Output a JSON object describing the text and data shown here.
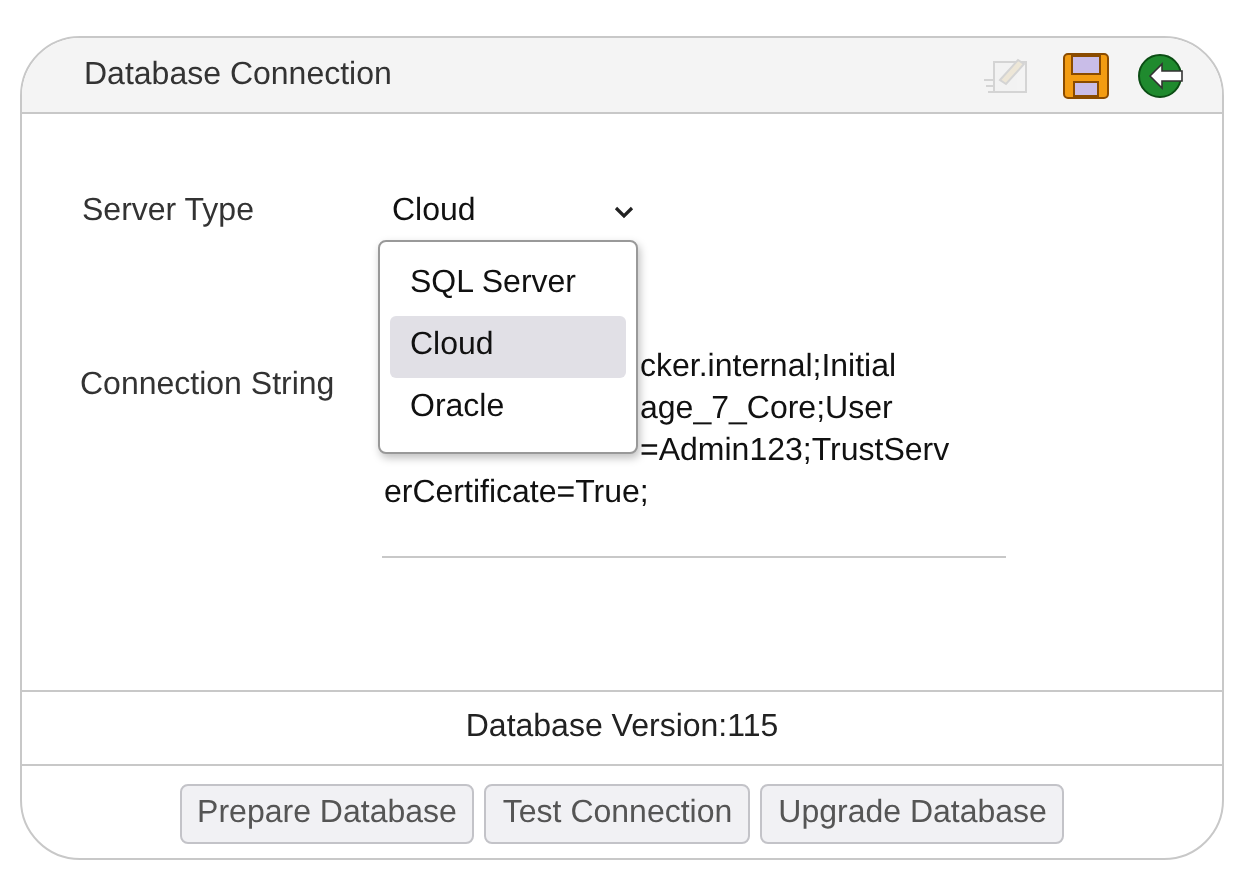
{
  "panel": {
    "title": "Database Connection"
  },
  "toolbar": [
    {
      "kind": "edit",
      "disabled": true
    },
    {
      "kind": "save",
      "disabled": false
    },
    {
      "kind": "back",
      "disabled": false
    }
  ],
  "server_type": {
    "label": "Server Type",
    "value": "Cloud",
    "options": [
      {
        "label": "SQL Server",
        "selected": false
      },
      {
        "label": "Cloud",
        "selected": true
      },
      {
        "label": "Oracle",
        "selected": false
      }
    ]
  },
  "connection_string": {
    "label": "Connection String",
    "lines": [
      {
        "text": "cker.internal;Initial",
        "covered": true
      },
      {
        "text": "age_7_Core;User",
        "covered": true
      },
      {
        "text": "=Admin123;TrustServ",
        "covered": true
      },
      {
        "text": "erCertificate=True;",
        "covered": false
      }
    ]
  },
  "database_version": "Database Version:115",
  "buttons": [
    "Prepare Database",
    "Test Connection",
    "Upgrade Database"
  ]
}
